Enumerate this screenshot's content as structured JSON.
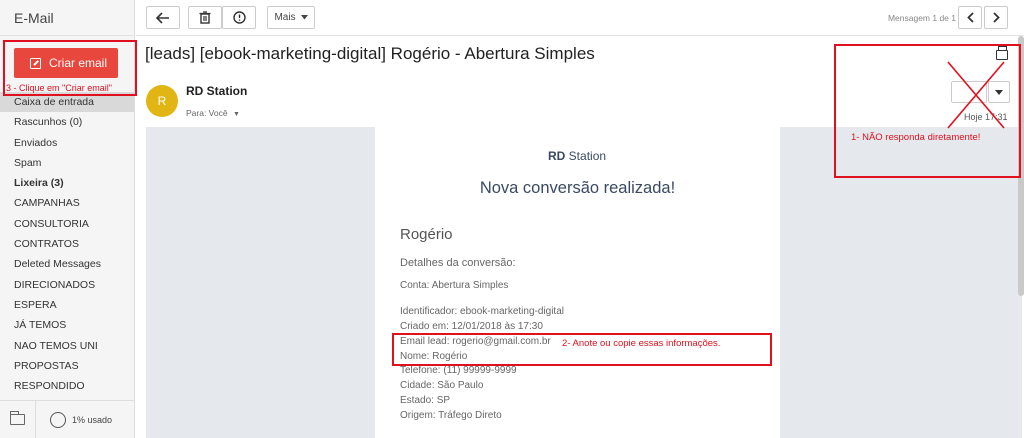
{
  "sidebar": {
    "app_title": "E-Mail",
    "compose_label": "Criar email",
    "folders": [
      {
        "label": "Caixa de entrada"
      },
      {
        "label": "Rascunhos (0)"
      },
      {
        "label": "Enviados"
      },
      {
        "label": "Spam"
      },
      {
        "label": "Lixeira (3)"
      },
      {
        "label": "CAMPANHAS"
      },
      {
        "label": "CONSULTORIA"
      },
      {
        "label": "CONTRATOS"
      },
      {
        "label": "Deleted Messages"
      },
      {
        "label": "DIRECIONADOS"
      },
      {
        "label": "ESPERA"
      },
      {
        "label": "JÁ TEMOS"
      },
      {
        "label": "NAO TEMOS UNI"
      },
      {
        "label": "PROPOSTAS"
      },
      {
        "label": "RESPONDIDO"
      }
    ],
    "usage_label": "1% usado"
  },
  "toolbar": {
    "more_label": "Mais",
    "message_count": "Mensagem 1 de 1"
  },
  "message": {
    "subject": "[leads] [ebook-marketing-digital] Rogério - Abertura Simples",
    "avatar_initial": "R",
    "sender": "RD Station",
    "to_line": "Para: Você",
    "time": "Hoje 17:31"
  },
  "email_body": {
    "logo_bold": "RD",
    "logo_rest": " Station",
    "title": "Nova conversão realizada!",
    "lead_name": "Rogério",
    "conversion_label": "Detalhes da conversão:",
    "conta": "Conta: Abertura Simples",
    "identificador": "Identificador: ebook-marketing-digital",
    "criado_em": "Criado em: 12/01/2018 às 17:30",
    "email_lead": "Email lead: rogerio@gmail.com.br",
    "nome": "Nome: Rogério",
    "telefone": "Telefone: (11) 99999-9999",
    "cidade": "Cidade: São Paulo",
    "estado": "Estado: SP",
    "origem": "Origem: Tráfego Direto"
  },
  "annotations": {
    "step1": "1- NÃO responda diretamente!",
    "step2": "2- Anote ou copie essas informações.",
    "step3": "3 - Clique em \"Criar email\""
  },
  "colors": {
    "accent": "#e8473d",
    "annotation": "#e0101f",
    "avatar": "#e0b514"
  }
}
